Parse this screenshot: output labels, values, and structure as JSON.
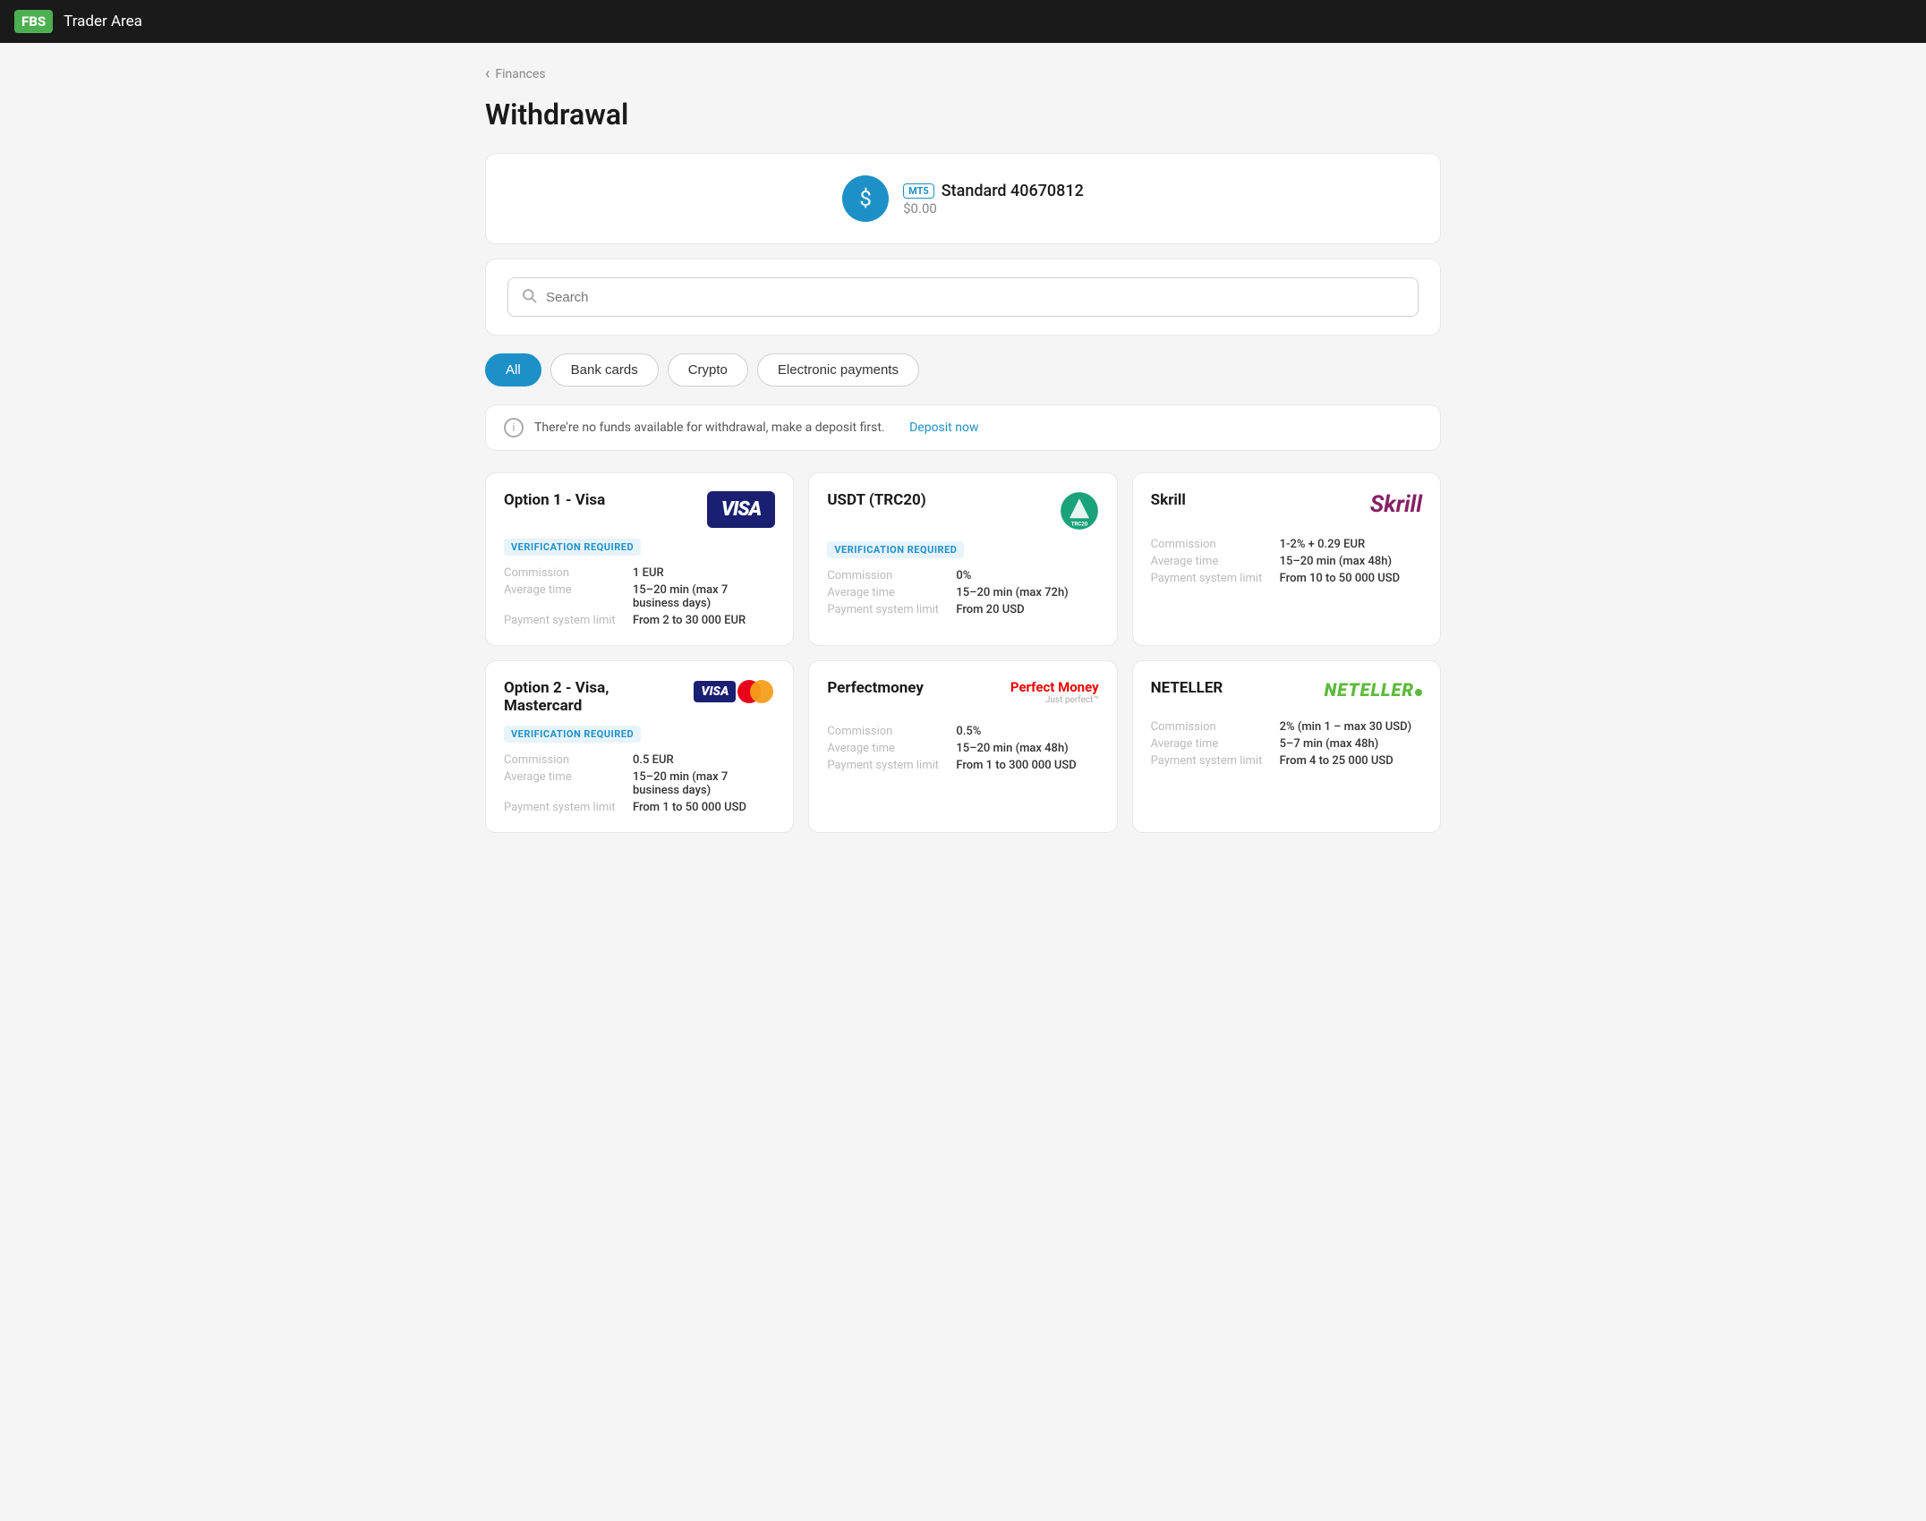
{
  "header": {
    "logo": "FBS",
    "title": "Trader Area"
  },
  "breadcrumb": {
    "back_label": "Finances"
  },
  "page": {
    "title": "Withdrawal"
  },
  "account": {
    "icon": "$",
    "badge": "MT5",
    "name": "Standard 40670812",
    "balance": "$0.00"
  },
  "search": {
    "placeholder": "Search"
  },
  "filters": [
    {
      "id": "all",
      "label": "All",
      "active": true
    },
    {
      "id": "bank-cards",
      "label": "Bank cards",
      "active": false
    },
    {
      "id": "crypto",
      "label": "Crypto",
      "active": false
    },
    {
      "id": "electronic",
      "label": "Electronic payments",
      "active": false
    }
  ],
  "warning": {
    "text": "There're no funds available for withdrawal, make a deposit first.",
    "link_text": "Deposit now"
  },
  "payment_methods": [
    {
      "name": "Option 1 - Visa",
      "logo_type": "visa",
      "verification_required": true,
      "commission_label": "Commission",
      "commission_value": "1 EUR",
      "avg_time_label": "Average time",
      "avg_time_value": "15–20 min (max 7 business days)",
      "limit_label": "Payment system limit",
      "limit_value": "From 2 to 30 000 EUR"
    },
    {
      "name": "USDT (TRC20)",
      "logo_type": "trc20",
      "verification_required": true,
      "commission_label": "Commission",
      "commission_value": "0%",
      "avg_time_label": "Average time",
      "avg_time_value": "15–20 min (max 72h)",
      "limit_label": "Payment system limit",
      "limit_value": "From 20 USD"
    },
    {
      "name": "Skrill",
      "logo_type": "skrill",
      "verification_required": false,
      "commission_label": "Commission",
      "commission_value": "1-2% + 0.29 EUR",
      "avg_time_label": "Average time",
      "avg_time_value": "15–20 min (max 48h)",
      "limit_label": "Payment system limit",
      "limit_value": "From 10 to 50 000 USD"
    },
    {
      "name": "Option 2 - Visa, Mastercard",
      "logo_type": "visa-mc",
      "verification_required": true,
      "commission_label": "Commission",
      "commission_value": "0.5 EUR",
      "avg_time_label": "Average time",
      "avg_time_value": "15–20 min (max 7 business days)",
      "limit_label": "Payment system limit",
      "limit_value": "From 1 to 50 000 USD"
    },
    {
      "name": "Perfectmoney",
      "logo_type": "perfectmoney",
      "verification_required": false,
      "commission_label": "Commission",
      "commission_value": "0.5%",
      "avg_time_label": "Average time",
      "avg_time_value": "15–20 min (max 48h)",
      "limit_label": "Payment system limit",
      "limit_value": "From 1 to 300 000 USD"
    },
    {
      "name": "NETELLER",
      "logo_type": "neteller",
      "verification_required": false,
      "commission_label": "Commission",
      "commission_value": "2% (min 1 – max 30 USD)",
      "avg_time_label": "Average time",
      "avg_time_value": "5–7 min (max 48h)",
      "limit_label": "Payment system limit",
      "limit_value": "From 4 to 25 000 USD"
    }
  ],
  "colors": {
    "accent": "#1e90c8",
    "header_bg": "#1a1a1a",
    "logo_bg": "#4caf50"
  }
}
